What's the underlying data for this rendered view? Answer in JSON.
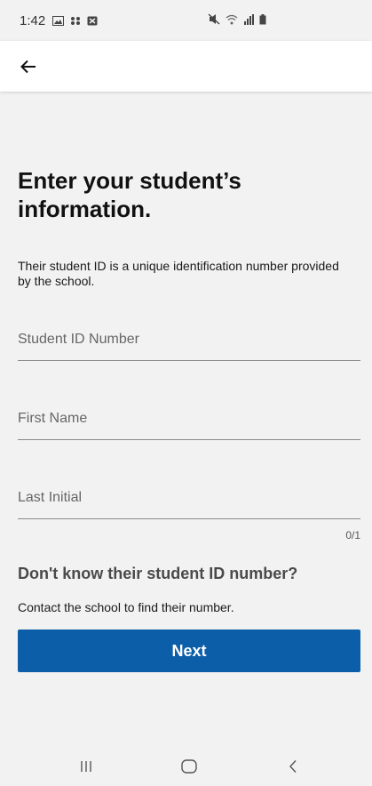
{
  "status_bar": {
    "time": "1:42",
    "left_icons": [
      "image-icon",
      "grid-icon",
      "notification-icon"
    ],
    "right_icons": [
      "mute-icon",
      "wifi-icon",
      "signal-icon",
      "battery-icon"
    ]
  },
  "app_bar": {
    "back_icon": "arrow-left-icon"
  },
  "main": {
    "title": "Enter your student’s information.",
    "helper_text": "Their student ID is a unique identification number provided by the school.",
    "fields": [
      {
        "placeholder": "Student ID Number",
        "value": ""
      },
      {
        "placeholder": "First Name",
        "value": ""
      },
      {
        "placeholder": "Last Initial",
        "value": ""
      }
    ],
    "last_initial_counter": "0/1",
    "help_heading": "Don't know their student ID number?",
    "help_text": "Contact the school to find their number.",
    "next_label": "Next"
  },
  "colors": {
    "primary": "#0d5ea8",
    "background": "#f2f2f2"
  },
  "nav_bar": {
    "icons": [
      "recent-apps-icon",
      "home-icon",
      "back-icon"
    ]
  }
}
